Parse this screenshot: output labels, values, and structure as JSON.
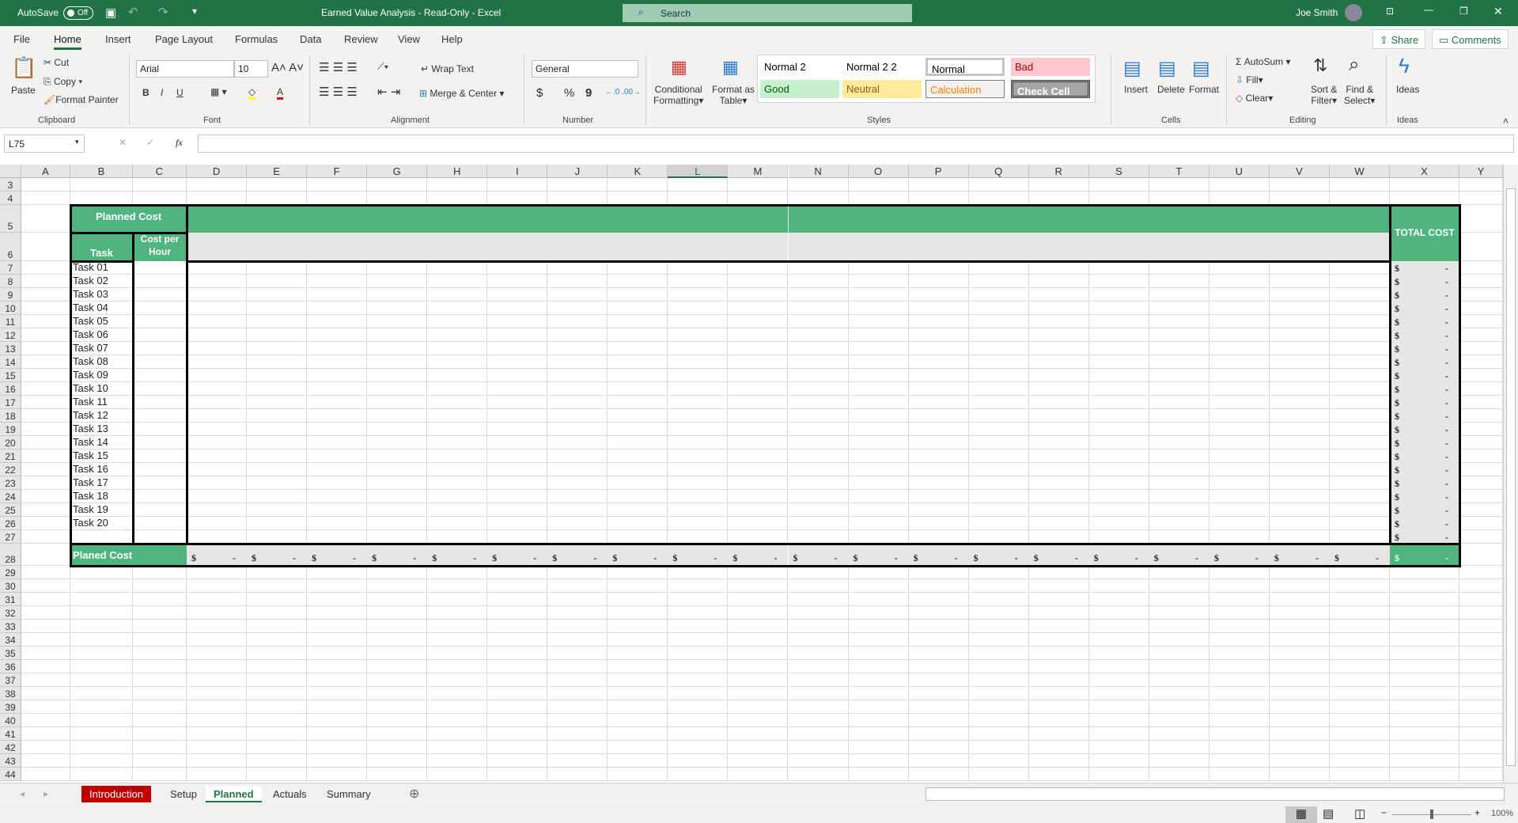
{
  "titlebar": {
    "autosave": "AutoSave",
    "toggle": "Off",
    "title": "Earned Value Analysis  -  Read-Only  -  Excel",
    "search": "Search",
    "user": "Joe Smith"
  },
  "menu": {
    "tabs": [
      "File",
      "Home",
      "Insert",
      "Page Layout",
      "Formulas",
      "Data",
      "Review",
      "View",
      "Help"
    ],
    "share": "Share",
    "comments": "Comments"
  },
  "ribbon": {
    "clipboard": {
      "paste": "Paste",
      "cut": "Cut",
      "copy": "Copy",
      "format_painter": "Format Painter",
      "label": "Clipboard"
    },
    "font": {
      "name": "Arial",
      "size": "10",
      "bold": "B",
      "italic": "I",
      "underline": "U",
      "label": "Font"
    },
    "alignment": {
      "wrap": "Wrap Text",
      "merge": "Merge & Center",
      "label": "Alignment"
    },
    "number": {
      "format": "General",
      "dollar": "$",
      "percent": "%",
      "comma": "9",
      "label": "Number"
    },
    "styles": {
      "conditional": "Conditional",
      "conditional2": "Formatting",
      "format_table": "Format as",
      "format_table2": "Table",
      "cells": [
        {
          "label": "Normal 2",
          "bg": "#ffffff",
          "fg": "#000000"
        },
        {
          "label": "Normal 2 2",
          "bg": "#ffffff",
          "fg": "#000000"
        },
        {
          "label": "Normal",
          "bg": "#ffffff",
          "fg": "#000000"
        },
        {
          "label": "Bad",
          "bg": "#ffc7ce",
          "fg": "#9c0006"
        },
        {
          "label": "Good",
          "bg": "#c6efce",
          "fg": "#006100"
        },
        {
          "label": "Neutral",
          "bg": "#ffeb9c",
          "fg": "#9c5700"
        },
        {
          "label": "Calculation",
          "bg": "#f2f2f2",
          "fg": "#fa7d00"
        },
        {
          "label": "Check Cell",
          "bg": "#a5a5a5",
          "fg": "#ffffff"
        }
      ],
      "label": "Styles"
    },
    "cells": {
      "insert": "Insert",
      "delete": "Delete",
      "format": "Format",
      "label": "Cells"
    },
    "editing": {
      "autosum": "AutoSum",
      "fill": "Fill",
      "clear": "Clear",
      "sort": "Sort &",
      "sort2": "Filter",
      "find": "Find &",
      "find2": "Select",
      "label": "Editing"
    },
    "ideas": {
      "ideas": "Ideas",
      "label": "Ideas"
    }
  },
  "formula_bar": {
    "name_box": "L75",
    "fx": "fx",
    "value": ""
  },
  "sheet": {
    "columns": [
      "A",
      "B",
      "C",
      "D",
      "E",
      "F",
      "G",
      "H",
      "I",
      "J",
      "K",
      "L",
      "M",
      "N",
      "O",
      "P",
      "Q",
      "R",
      "S",
      "T",
      "U",
      "V",
      "W",
      "X",
      "Y"
    ],
    "selected_column": "L",
    "rows": [
      3,
      4,
      5,
      6,
      7,
      8,
      9,
      10,
      11,
      12,
      13,
      14,
      15,
      16,
      17,
      18,
      19,
      20,
      21,
      22,
      23,
      24,
      25,
      26,
      27,
      28,
      29,
      30,
      31,
      32,
      33,
      34,
      35,
      36,
      37,
      38,
      39,
      40,
      41,
      42,
      43,
      44
    ],
    "planned_cost": "Planned Cost",
    "task_header": "Task",
    "cost_header": "Cost per Hour",
    "total_header": "TOTAL COST",
    "tasks": [
      "Task 01",
      "Task 02",
      "Task 03",
      "Task 04",
      "Task 05",
      "Task 06",
      "Task 07",
      "Task 08",
      "Task 09",
      "Task 10",
      "Task 11",
      "Task 12",
      "Task 13",
      "Task 14",
      "Task 15",
      "Task 16",
      "Task 17",
      "Task 18",
      "Task 19",
      "Task 20"
    ],
    "currency": "$",
    "empty_value": "-",
    "total_row_label": "Planed Cost",
    "header_green": "#4fb47d"
  },
  "sheet_tabs": [
    {
      "label": "Introduction",
      "bg": "#c00000"
    },
    {
      "label": "Setup"
    },
    {
      "label": "Planned",
      "active": true
    },
    {
      "label": "Actuals"
    },
    {
      "label": "Summary"
    }
  ],
  "status": {
    "zoom": "100%"
  }
}
